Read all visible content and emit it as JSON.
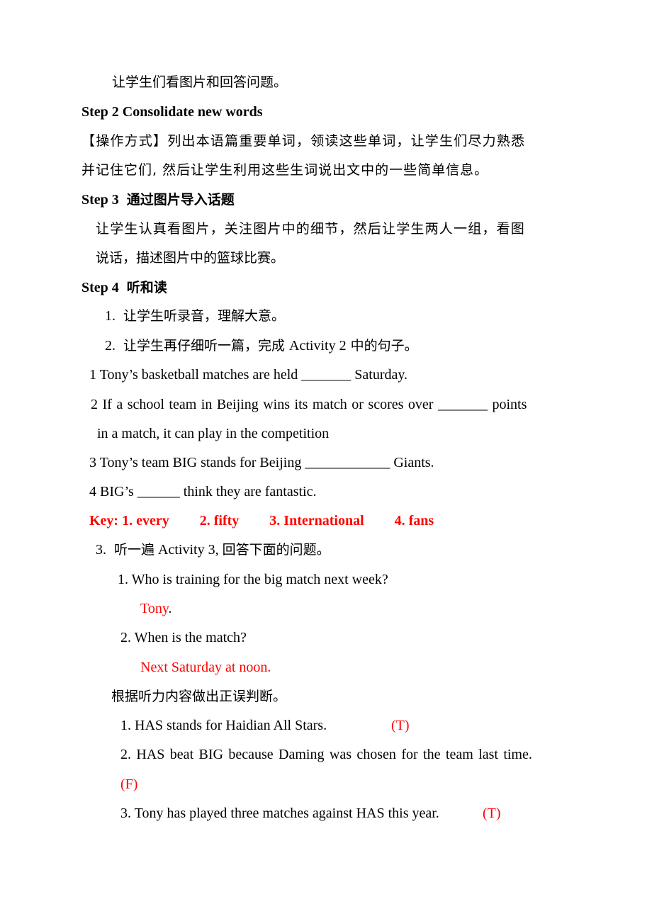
{
  "document": {
    "intro_line": "让学生们看图片和回答问题。",
    "step2": {
      "title": "Step 2 Consolidate new words",
      "method_line1": "【操作方式】列出本语篇重要单词，领读这些单词，让学生们尽力熟悉",
      "method_line2": "并记住它们, 然后让学生利用这些生词说出文中的一些简单信息。"
    },
    "step3": {
      "title_prefix": "Step 3",
      "title_zh": "通过图片导入话题",
      "line1": "让学生认真看图片，关注图片中的细节，然后让学生两人一组，看图",
      "line2": "说话，描述图片中的篮球比赛。"
    },
    "step4": {
      "title_prefix": "Step 4",
      "title_zh": "听和读",
      "tasks": [
        {
          "num": "1.",
          "text": "让学生听录音，理解大意。"
        },
        {
          "num": "2.",
          "text_pre": "让学生再仔细听一篇，完成 ",
          "text_en": "Activity 2",
          "text_post": " 中的句子。"
        }
      ],
      "activity2_sentences": [
        "1 Tony’s basketball matches are held _______ Saturday.",
        "2 If a school team in Beijing wins its match or scores over _______ points",
        "in a match, it can play in the competition",
        "3 Tony’s team BIG stands for Beijing ____________ Giants.",
        "4 BIG’s ______ think they are fantastic."
      ],
      "key": {
        "label": "Key: 1. every",
        "answers": [
          "2. fifty",
          "3. International",
          "4. fans"
        ]
      },
      "task3": {
        "num": "3.",
        "text_pre": "听一遍",
        "text_en": " Activity 3,  ",
        "text_post": "回答下面的问题。"
      },
      "questions": [
        {
          "q": "1. Who is training for the big match next week?",
          "answer": "Tony",
          "answer_suffix": "."
        },
        {
          "q": "2. When is the match?",
          "answer": "Next Saturday at noon.",
          "answer_suffix": ""
        }
      ],
      "tf_instruction": "根据听力内容做出正误判断。",
      "tf_items": [
        {
          "statement": "1. HAS stands for Haidian All Stars.",
          "answer": "(T)"
        },
        {
          "statement": "2. HAS beat BIG because Daming was chosen for the team last time.",
          "answer": "(F)"
        },
        {
          "statement": "3. Tony has played three matches against HAS this year.",
          "answer": "(T)"
        }
      ]
    }
  },
  "colors": {
    "text": "#000000",
    "answer": "#ff0000"
  }
}
